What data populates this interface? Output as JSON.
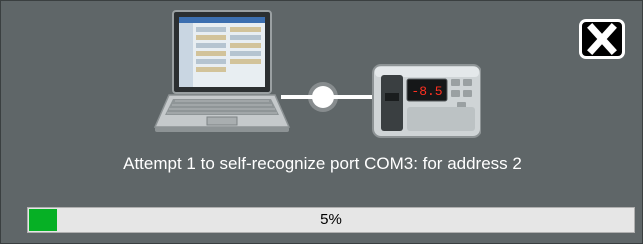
{
  "dialog": {
    "message": "Attempt 1 to self-recognize port COM3: for address 2",
    "controller_display": "-8.5",
    "progress": {
      "value_percent": 5,
      "label": "5%"
    },
    "close_icon": "close-x-icon",
    "colors": {
      "background": "#5f6668",
      "progress_fill": "#06b025",
      "progress_track": "#e6e6e6",
      "display_digits": "#ff3020"
    }
  }
}
